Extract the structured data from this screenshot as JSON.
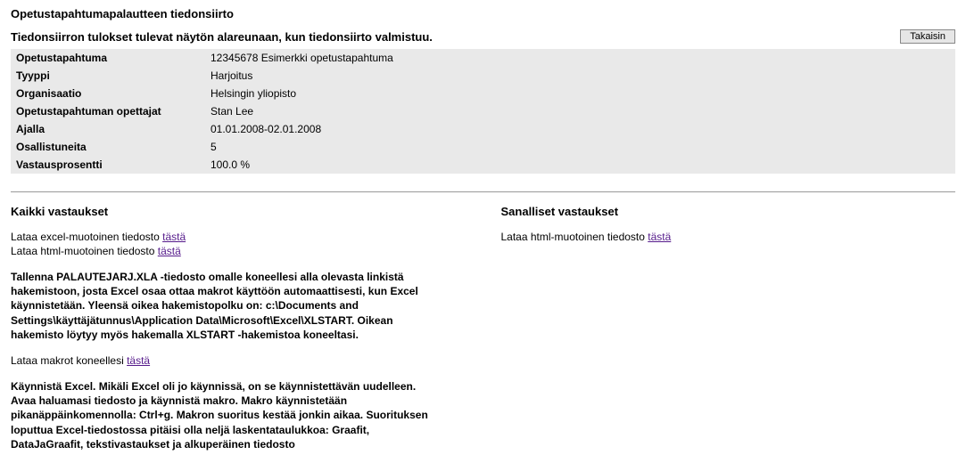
{
  "header": {
    "pageTitle": "Opetustapahtumapalautteen tiedonsiirto",
    "subtitle": "Tiedonsiirron tulokset tulevat näytön alareunaan, kun tiedonsiirto valmistuu.",
    "backButton": "Takaisin"
  },
  "info": {
    "rows": [
      {
        "label": "Opetustapahtuma",
        "value": "12345678 Esimerkki opetustapahtuma"
      },
      {
        "label": "Tyyppi",
        "value": "Harjoitus"
      },
      {
        "label": "Organisaatio",
        "value": "Helsingin yliopisto"
      },
      {
        "label": "Opetustapahtuman opettajat",
        "value": "Stan Lee"
      },
      {
        "label": "Ajalla",
        "value": "01.01.2008-02.01.2008"
      },
      {
        "label": "Osallistuneita",
        "value": "5"
      },
      {
        "label": "Vastausprosentti",
        "value": "100.0 %"
      }
    ]
  },
  "left": {
    "title": "Kaikki vastaukset",
    "line1_prefix": "Lataa excel-muotoinen tiedosto ",
    "line1_link": "tästä",
    "line2_prefix": "Lataa html-muotoinen tiedosto ",
    "line2_link": "tästä",
    "para1": "Tallenna PALAUTEJARJ.XLA -tiedosto omalle koneellesi alla olevasta linkistä hakemistoon, josta Excel osaa ottaa makrot käyttöön automaattisesti, kun Excel käynnistetään. Yleensä oikea hakemistopolku on: c:\\Documents and Settings\\käyttäjätunnus\\Application Data\\Microsoft\\Excel\\XLSTART. Oikean hakemisto löytyy myös hakemalla XLSTART -hakemistoa koneeltasi.",
    "line3_prefix": "Lataa makrot koneellesi ",
    "line3_link": "tästä",
    "para2": "Käynnistä Excel. Mikäli Excel oli jo käynnissä, on se käynnistettävän uudelleen. Avaa haluamasi tiedosto ja käynnistä makro. Makro käynnistetään pikanäppäinkomennolla: Ctrl+g. Makron suoritus kestää jonkin aikaa. Suorituksen loputtua Excel-tiedostossa pitäisi olla neljä laskentataulukkoa: Graafit, DataJaGraafit, tekstivastaukset ja alkuperäinen tiedosto"
  },
  "right": {
    "title": "Sanalliset vastaukset",
    "line1_prefix": "Lataa html-muotoinen tiedosto ",
    "line1_link": "tästä"
  }
}
